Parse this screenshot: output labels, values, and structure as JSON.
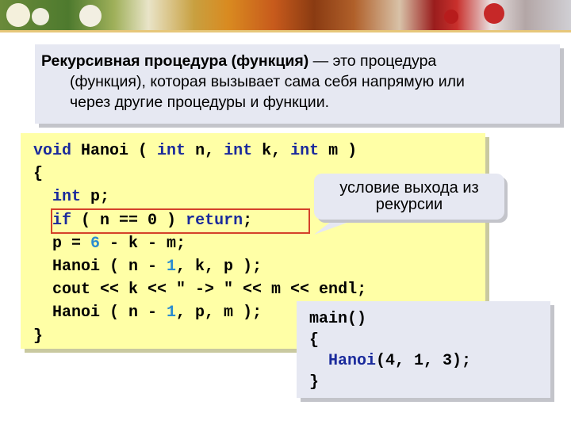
{
  "definition": {
    "term": "Рекурсивная процедура (функция)",
    "rest_line1": " — это процедура",
    "line2": "(функция), которая вызывает сама себя напрямую или",
    "line3": "через другие процедуры и функции."
  },
  "code": {
    "l1": {
      "kw1": "void",
      "name": " Hanoi ( ",
      "kw2": "int",
      "p2": " n, ",
      "kw3": "int",
      "p3": " k, ",
      "kw4": "int",
      "p4": " m )"
    },
    "l2": "{",
    "l3": {
      "indent": "  ",
      "kw": "int",
      "rest": " p;"
    },
    "l4": {
      "indent": "  ",
      "kw1": "if",
      "mid": " ( n == 0 ) ",
      "kw2": "return",
      "end": ";"
    },
    "l5": {
      "a": "  p = ",
      "n1": "6",
      "b": " - k - m;"
    },
    "l6": {
      "a": "  Hanoi ( n - ",
      "n1": "1",
      "b": ", k, p );"
    },
    "l7": "  cout << k << \" -> \" << m << endl;",
    "l8": {
      "a": "  Hanoi ( n - ",
      "n1": "1",
      "b": ", p, m );"
    },
    "l9": "}"
  },
  "callout": {
    "line1": "условие выхода из",
    "line2": "рекурсии"
  },
  "main_code": {
    "l1": "main()",
    "l2": "{",
    "l3": {
      "indent": "  ",
      "fn": "Hanoi",
      "args": "(4, 1, 3);"
    },
    "l4": "}"
  },
  "colors": {
    "keyword": "#1a2a9c",
    "number": "#2a8cd0",
    "highlight_frame": "#d4412a",
    "code_bg": "#ffffa6",
    "box_bg": "#e6e8f2"
  }
}
